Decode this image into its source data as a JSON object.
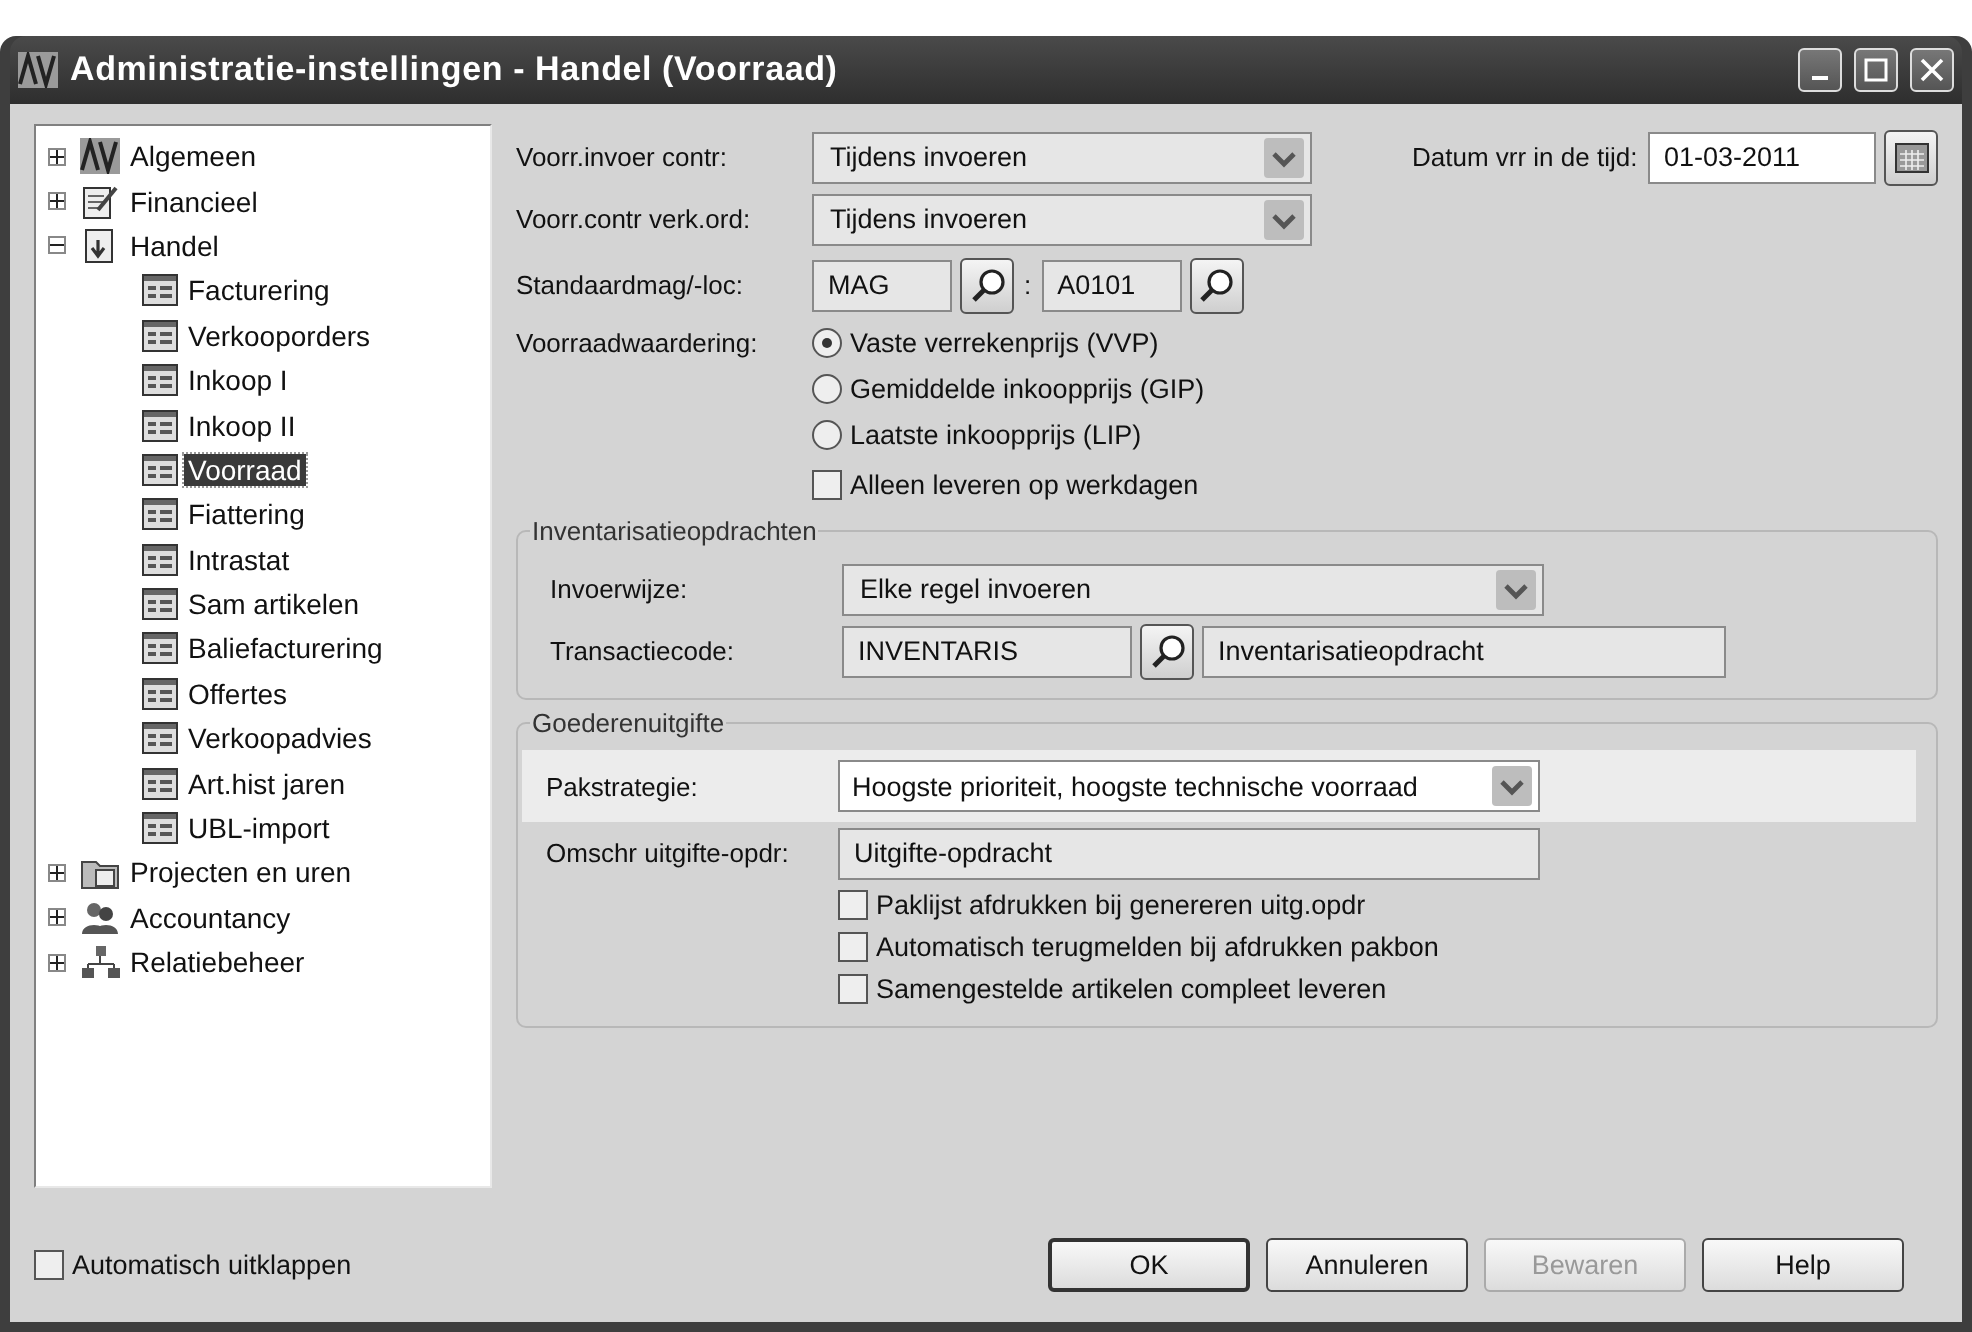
{
  "window": {
    "title": "Administratie-instellingen - Handel (Voorraad)"
  },
  "tree": [
    {
      "label": "Algemeen",
      "expanded": false,
      "selected": false
    },
    {
      "label": "Financieel",
      "expanded": false,
      "selected": false
    },
    {
      "label": "Handel",
      "expanded": true,
      "selected": false,
      "children": [
        {
          "label": "Facturering",
          "selected": false
        },
        {
          "label": "Verkooporders",
          "selected": false
        },
        {
          "label": "Inkoop I",
          "selected": false
        },
        {
          "label": "Inkoop II",
          "selected": false
        },
        {
          "label": "Voorraad",
          "selected": true
        },
        {
          "label": "Fiattering",
          "selected": false
        },
        {
          "label": "Intrastat",
          "selected": false
        },
        {
          "label": "Sam artikelen",
          "selected": false
        },
        {
          "label": "Baliefacturering",
          "selected": false
        },
        {
          "label": "Offertes",
          "selected": false
        },
        {
          "label": "Verkoopadvies",
          "selected": false
        },
        {
          "label": "Art.hist jaren",
          "selected": false
        },
        {
          "label": "UBL-import",
          "selected": false
        }
      ]
    },
    {
      "label": "Projecten en uren",
      "expanded": false,
      "selected": false
    },
    {
      "label": "Accountancy",
      "expanded": false,
      "selected": false
    },
    {
      "label": "Relatiebeheer",
      "expanded": false,
      "selected": false
    }
  ],
  "auto_expand": {
    "label": "Automatisch uitklappen",
    "checked": false
  },
  "general": {
    "stock_check_entry": {
      "label": "Voorr.invoer contr:",
      "value": "Tijdens invoeren"
    },
    "stock_check_sales": {
      "label": "Voorr.contr verk.ord:",
      "value": "Tijdens invoeren"
    },
    "default_location": {
      "label": "Standaardmag/-loc:",
      "warehouse": "MAG",
      "separator": ":",
      "location": "A0101"
    },
    "date": {
      "label": "Datum vrr in de tijd:",
      "value": "01-03-2011"
    },
    "valuation": {
      "label": "Voorraadwaardering:",
      "options": [
        {
          "label": "Vaste verrekenprijs (VVP)",
          "selected": true
        },
        {
          "label": "Gemiddelde inkoopprijs (GIP)",
          "selected": false
        },
        {
          "label": "Laatste inkoopprijs (LIP)",
          "selected": false
        }
      ]
    },
    "workdays_only": {
      "label": "Alleen leveren op werkdagen",
      "checked": false
    }
  },
  "inventory": {
    "title": "Inventarisatieopdrachten",
    "entry_mode": {
      "label": "Invoerwijze:",
      "value": "Elke regel invoeren"
    },
    "transaction": {
      "label": "Transactiecode:",
      "code": "INVENTARIS",
      "description": "Inventarisatieopdracht"
    }
  },
  "goods_issue": {
    "title": "Goederenuitgifte",
    "strategy": {
      "label": "Pakstrategie:",
      "value": "Hoogste prioriteit, hoogste technische voorraad",
      "highlighted": true
    },
    "description": {
      "label": "Omschr uitgifte-opdr:",
      "value": "Uitgifte-opdracht"
    },
    "options": [
      {
        "label": "Paklijst afdrukken bij genereren uitg.opdr",
        "checked": false
      },
      {
        "label": "Automatisch terugmelden bij afdrukken pakbon",
        "checked": false
      },
      {
        "label": "Samengestelde artikelen compleet leveren",
        "checked": false
      }
    ]
  },
  "buttons": [
    {
      "label": "OK",
      "disabled": false,
      "default": true
    },
    {
      "label": "Annuleren",
      "disabled": false,
      "default": false
    },
    {
      "label": "Bewaren",
      "disabled": true,
      "default": false
    },
    {
      "label": "Help",
      "disabled": false,
      "default": false
    }
  ]
}
